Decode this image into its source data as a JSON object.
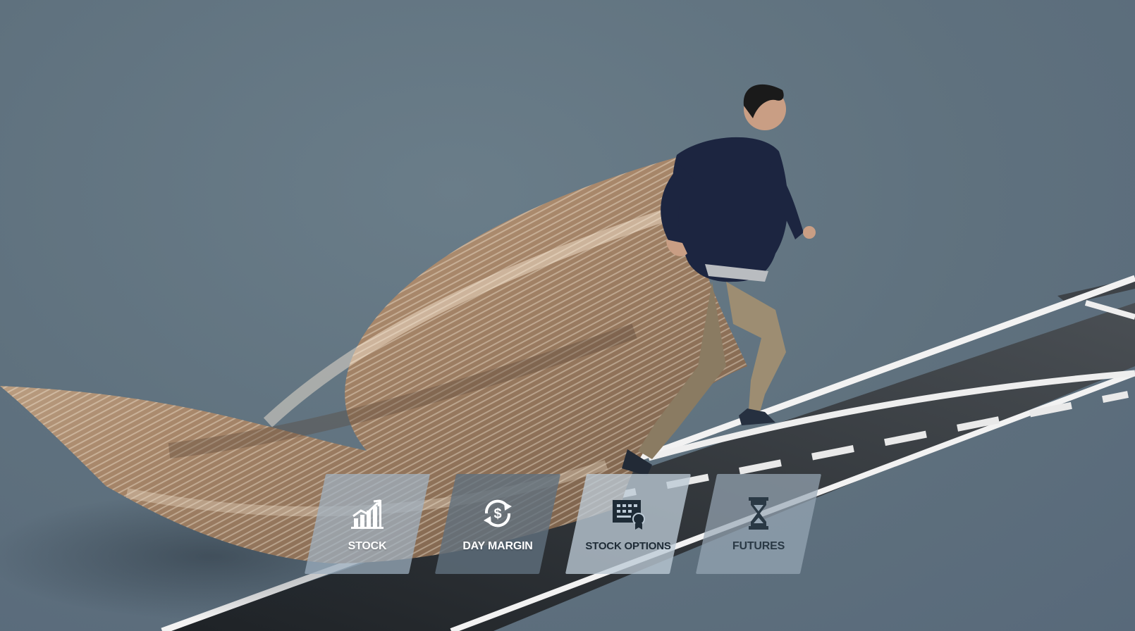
{
  "hero": {
    "description_hidden": ""
  },
  "tiles": [
    {
      "label": "STOCK",
      "icon": "bar-chart-rising-icon"
    },
    {
      "label": "DAY MARGIN",
      "icon": "dollar-cycle-icon"
    },
    {
      "label": "STOCK OPTIONS",
      "icon": "certificate-icon"
    },
    {
      "label": "FUTURES",
      "icon": "hourglass-icon"
    }
  ],
  "colors": {
    "background": "#607380",
    "track": "#3b4045",
    "track_lines": "#f2f2f2",
    "fabric": "#b79a7a"
  }
}
